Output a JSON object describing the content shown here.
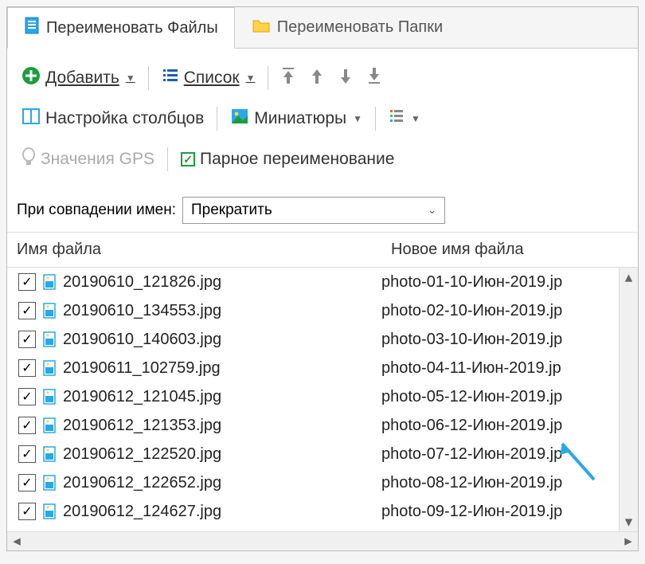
{
  "tabs": {
    "files": "Переименовать Файлы",
    "folders": "Переименовать Папки"
  },
  "toolbar": {
    "add": "Добавить",
    "list": "Список",
    "columns": "Настройка столбцов",
    "thumbnails": "Миниатюры",
    "gps": "Значения GPS",
    "paired": "Парное переименование"
  },
  "collision": {
    "label": "При совпадении имен:",
    "value": "Прекратить"
  },
  "headers": {
    "name": "Имя файла",
    "newname": "Новое имя файла"
  },
  "rows": [
    {
      "checked": true,
      "name": "20190610_121826.jpg",
      "newname": "photo-01-10-Июн-2019.jp"
    },
    {
      "checked": true,
      "name": "20190610_134553.jpg",
      "newname": "photo-02-10-Июн-2019.jp"
    },
    {
      "checked": true,
      "name": "20190610_140603.jpg",
      "newname": "photo-03-10-Июн-2019.jp"
    },
    {
      "checked": true,
      "name": "20190611_102759.jpg",
      "newname": "photo-04-11-Июн-2019.jp"
    },
    {
      "checked": true,
      "name": "20190612_121045.jpg",
      "newname": "photo-05-12-Июн-2019.jp"
    },
    {
      "checked": true,
      "name": "20190612_121353.jpg",
      "newname": "photo-06-12-Июн-2019.jp"
    },
    {
      "checked": true,
      "name": "20190612_122520.jpg",
      "newname": "photo-07-12-Июн-2019.jp"
    },
    {
      "checked": true,
      "name": "20190612_122652.jpg",
      "newname": "photo-08-12-Июн-2019.jp"
    },
    {
      "checked": true,
      "name": "20190612_124627.jpg",
      "newname": "photo-09-12-Июн-2019.jp"
    }
  ]
}
